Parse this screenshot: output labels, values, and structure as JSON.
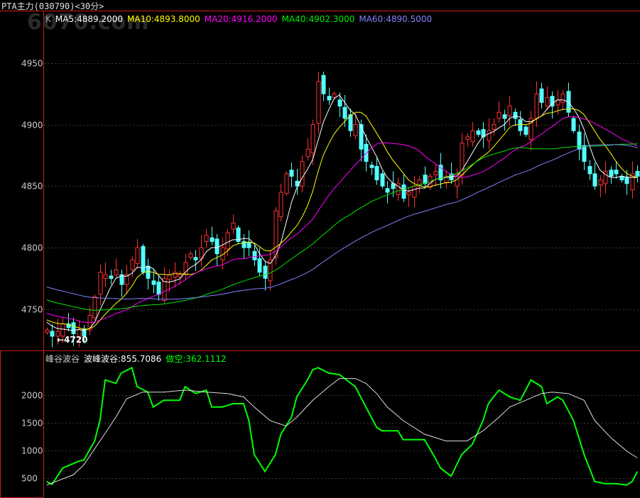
{
  "title": "PTA主力(030790)<30分>",
  "watermark": "6070.com",
  "colors": {
    "up": "#ff3232",
    "down": "#54ffff",
    "ma5": "#ffffff",
    "ma10": "#ffff00",
    "ma20": "#ff00ff",
    "ma40": "#00e600",
    "ma60": "#8080ff",
    "frame": "#c81e1e",
    "grid": "#3a3a3a",
    "green_line": "#00ff00",
    "white_line": "#dddddd"
  },
  "legend": {
    "k": "K",
    "ma5": "MA5:4889.2000",
    "ma10": "MA10:4893.8000",
    "ma20": "MA20:4916.2000",
    "ma40": "MA40:4902.3000",
    "ma60": "MA60:4890.5000"
  },
  "indicator_legend": {
    "name": "峰谷波谷",
    "wave": "波峰波谷:855.7086",
    "short": "做空:362.1112"
  },
  "chart_data": [
    {
      "type": "candlestick",
      "title": "PTA主力(030790)<30分>",
      "yticks": [
        4950,
        4900,
        4850,
        4800,
        4750
      ],
      "ylim": [
        4717,
        4992
      ],
      "annotation": "←4720",
      "history_start": 4800,
      "history_end": 4738,
      "closes": [
        4733,
        4728,
        4732,
        4738,
        4735,
        4730,
        4733,
        4728,
        4745,
        4760,
        4780,
        4778,
        4775,
        4782,
        4770,
        4778,
        4790,
        4800,
        4780,
        4775,
        4770,
        4762,
        4775,
        4778,
        4780,
        4778,
        4788,
        4795,
        4790,
        4800,
        4810,
        4805,
        4795,
        4800,
        4812,
        4820,
        4805,
        4800,
        4800,
        4790,
        4780,
        4775,
        4790,
        4830,
        4845,
        4860,
        4858,
        4850,
        4870,
        4880,
        4900,
        4935,
        4925,
        4920,
        4925,
        4915,
        4905,
        4895,
        4900,
        4880,
        4870,
        4865,
        4855,
        4850,
        4845,
        4848,
        4852,
        4840,
        4845,
        4850,
        4855,
        4852,
        4858,
        4862,
        4855,
        4858,
        4855,
        4860,
        4885,
        4890,
        4895,
        4892,
        4890,
        4895,
        4900,
        4910,
        4905,
        4915,
        4905,
        4895,
        4892,
        4905,
        4925,
        4918,
        4922,
        4915,
        4920,
        4925,
        4910,
        4895,
        4880,
        4870,
        4860,
        4850,
        4855,
        4862,
        4858,
        4860,
        4855,
        4852,
        4860,
        4858
      ]
    },
    {
      "type": "line",
      "title": "峰谷波谷",
      "yticks": [
        2000,
        1500,
        1000,
        500
      ],
      "ylim": [
        170,
        2620
      ],
      "bars": 112,
      "series": [
        {
          "name": "做空",
          "color": "#00ff00",
          "points": [
            [
              0,
              439
            ],
            [
              1,
              390
            ],
            [
              3,
              683
            ],
            [
              6,
              805
            ],
            [
              7,
              829
            ],
            [
              9,
              1171
            ],
            [
              10,
              1537
            ],
            [
              11,
              2268
            ],
            [
              13,
              2207
            ],
            [
              14,
              2390
            ],
            [
              16,
              2488
            ],
            [
              17,
              2146
            ],
            [
              19,
              2049
            ],
            [
              20,
              1780
            ],
            [
              22,
              1902
            ],
            [
              25,
              1902
            ],
            [
              26,
              2146
            ],
            [
              28,
              2024
            ],
            [
              30,
              2085
            ],
            [
              31,
              1780
            ],
            [
              33,
              1780
            ],
            [
              35,
              1841
            ],
            [
              37,
              1841
            ],
            [
              38,
              1537
            ],
            [
              39,
              927
            ],
            [
              41,
              622
            ],
            [
              43,
              927
            ],
            [
              44,
              1293
            ],
            [
              46,
              1598
            ],
            [
              47,
              1963
            ],
            [
              49,
              2268
            ],
            [
              50,
              2451
            ],
            [
              51,
              2488
            ],
            [
              53,
              2390
            ],
            [
              55,
              2366
            ],
            [
              58,
              2146
            ],
            [
              60,
              1780
            ],
            [
              62,
              1415
            ],
            [
              63,
              1354
            ],
            [
              66,
              1354
            ],
            [
              67,
              1195
            ],
            [
              71,
              1195
            ],
            [
              73,
              866
            ],
            [
              74,
              683
            ],
            [
              76,
              537
            ],
            [
              78,
              927
            ],
            [
              80,
              1110
            ],
            [
              82,
              1537
            ],
            [
              83,
              1841
            ],
            [
              85,
              2085
            ],
            [
              87,
              1963
            ],
            [
              89,
              1902
            ],
            [
              91,
              2268
            ],
            [
              93,
              2146
            ],
            [
              94,
              1841
            ],
            [
              96,
              1963
            ],
            [
              97,
              1902
            ],
            [
              99,
              1537
            ],
            [
              100,
              1232
            ],
            [
              101,
              927
            ],
            [
              103,
              439
            ],
            [
              105,
              402
            ],
            [
              107,
              402
            ],
            [
              109,
              378
            ],
            [
              110,
              439
            ],
            [
              111,
              622
            ]
          ]
        },
        {
          "name": "波峰波谷",
          "color": "#dddddd",
          "points": [
            [
              0,
              378
            ],
            [
              5,
              561
            ],
            [
              7,
              744
            ],
            [
              10,
              1171
            ],
            [
              13,
              1598
            ],
            [
              15,
              1927
            ],
            [
              18,
              2049
            ],
            [
              22,
              2049
            ],
            [
              26,
              2085
            ],
            [
              30,
              2049
            ],
            [
              34,
              2024
            ],
            [
              37,
              1963
            ],
            [
              39,
              1780
            ],
            [
              42,
              1537
            ],
            [
              45,
              1439
            ],
            [
              47,
              1598
            ],
            [
              50,
              1902
            ],
            [
              53,
              2146
            ],
            [
              55,
              2293
            ],
            [
              58,
              2293
            ],
            [
              60,
              2207
            ],
            [
              62,
              2024
            ],
            [
              64,
              1780
            ],
            [
              67,
              1537
            ],
            [
              71,
              1293
            ],
            [
              75,
              1171
            ],
            [
              79,
              1171
            ],
            [
              82,
              1354
            ],
            [
              85,
              1598
            ],
            [
              87,
              1780
            ],
            [
              90,
              1902
            ],
            [
              93,
              2024
            ],
            [
              95,
              2049
            ],
            [
              98,
              2024
            ],
            [
              101,
              1902
            ],
            [
              103,
              1537
            ],
            [
              106,
              1232
            ],
            [
              109,
              988
            ],
            [
              111,
              866
            ]
          ]
        }
      ]
    }
  ]
}
